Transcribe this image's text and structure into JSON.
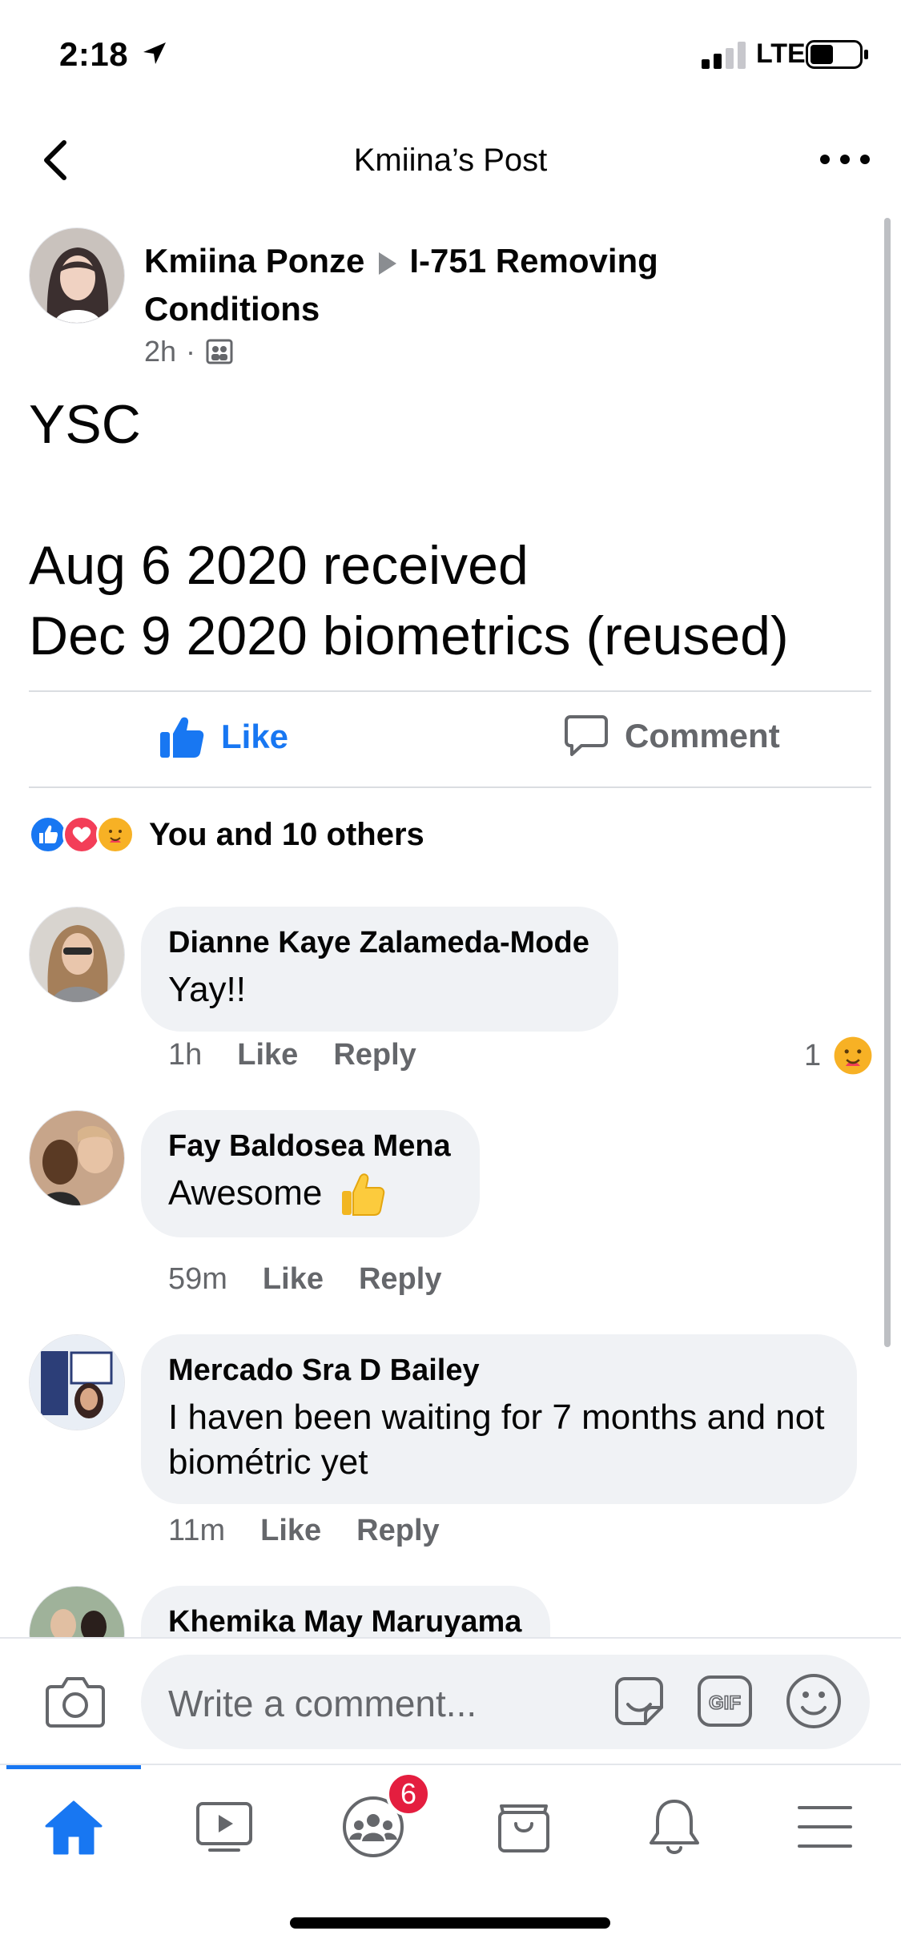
{
  "status_bar": {
    "time": "2:18",
    "network": "LTE"
  },
  "header": {
    "title": "Kmiina’s Post"
  },
  "post": {
    "author": "Kmiina Ponze",
    "group": "I-751 Removing Conditions",
    "time": "2h",
    "dot": "·",
    "body": "YSC\n\nAug 6 2020 received\nDec 9 2020 biometrics (reused)"
  },
  "actions": {
    "like": "Like",
    "comment": "Comment"
  },
  "reactions": {
    "summary": "You and 10 others"
  },
  "comments": [
    {
      "name": "Dianne Kaye Zalameda-Mode",
      "text": "Yay!!",
      "time": "1h",
      "like": "Like",
      "reply": "Reply",
      "reaction_count": "1"
    },
    {
      "name": "Fay Baldosea Mena",
      "text": "Awesome",
      "time": "59m",
      "like": "Like",
      "reply": "Reply"
    },
    {
      "name": "Mercado Sra D Bailey",
      "text": "I haven been waiting for 7 months and not biométric yet",
      "time": "11m",
      "like": "Like",
      "reply": "Reply"
    },
    {
      "name": "Khemika May Maruyama"
    }
  ],
  "composer": {
    "placeholder": "Write a comment..."
  },
  "tabbar": {
    "groups_badge": "6"
  },
  "colors": {
    "accent": "#1877f2",
    "badge": "#e41e3f",
    "bubble": "#f0f2f5",
    "meta": "#65676b"
  },
  "icons": [
    "back-icon",
    "more-icon",
    "like-icon",
    "comment-icon",
    "camera-icon",
    "sticker-icon",
    "gif-icon",
    "emoji-icon",
    "home-icon",
    "watch-icon",
    "groups-icon",
    "marketplace-icon",
    "bell-icon",
    "menu-icon"
  ]
}
